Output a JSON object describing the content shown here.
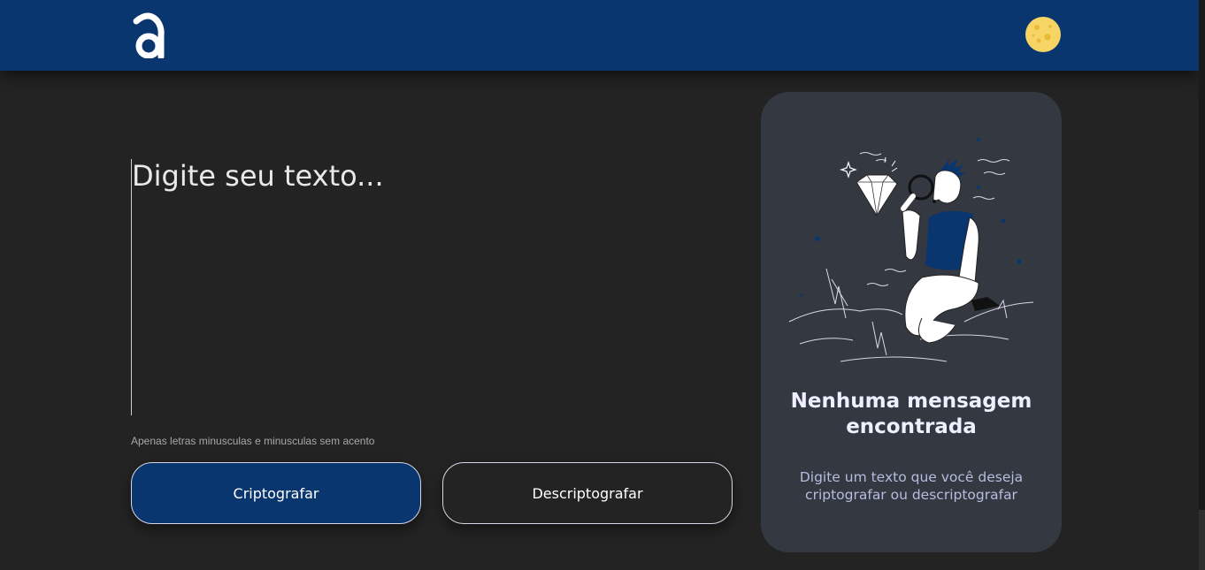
{
  "header": {
    "logo_letter": "a",
    "theme_toggle": "moon-icon"
  },
  "input": {
    "placeholder": "Digite seu texto...",
    "value": ""
  },
  "hint": "Apenas letras minusculas e minusculas sem acento",
  "buttons": {
    "encrypt": "Criptografar",
    "decrypt": "Descriptografar"
  },
  "output_panel": {
    "illustration": "person-magnifier-diamond-illustration",
    "title": "Nenhuma mensagem encontrada",
    "subtitle": "Digite um texto que você deseja criptografar ou descriptografar"
  },
  "colors": {
    "primary": "#0a3670",
    "background": "#232323",
    "panel": "#343840",
    "moon": "#f6d565"
  }
}
